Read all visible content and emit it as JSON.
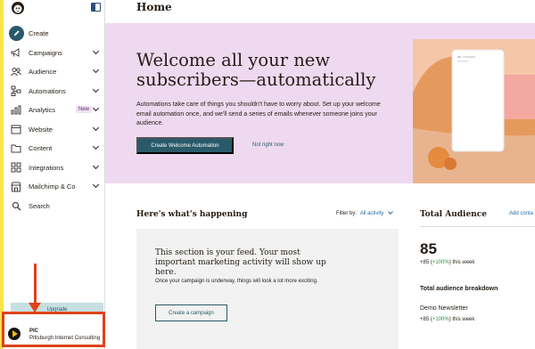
{
  "page": {
    "title": "Home"
  },
  "sidebar": {
    "items": [
      {
        "label": "Create",
        "icon": "pencil-icon"
      },
      {
        "label": "Campaigns",
        "icon": "megaphone-icon"
      },
      {
        "label": "Audience",
        "icon": "people-icon"
      },
      {
        "label": "Automations",
        "icon": "automation-icon"
      },
      {
        "label": "Analytics",
        "icon": "bar-chart-icon",
        "badge": "New"
      },
      {
        "label": "Website",
        "icon": "browser-window-icon"
      },
      {
        "label": "Content",
        "icon": "folder-icon"
      },
      {
        "label": "Integrations",
        "icon": "grid-icon"
      },
      {
        "label": "Mailchimp & Co",
        "icon": "store-icon"
      },
      {
        "label": "Search",
        "icon": "search-icon"
      }
    ],
    "upgrade_label": "Upgrade",
    "account": {
      "abbr": "PIC",
      "name": "Pittsburgh Internet Consulting"
    }
  },
  "hero": {
    "title": "Welcome all your new subscribers—automatically",
    "description": "Automations take care of things you shouldn't have to worry about. Set up your welcome email automation once, and we'll send a series of emails whenever someone joins your audience.",
    "primary_button": "Create Welcome Automation",
    "secondary_link": "Not right now"
  },
  "feed": {
    "heading": "Here's what's happening",
    "filter_label": "Filter by:",
    "filter_value": "All activity",
    "empty_title": "This section is your feed. Your most important marketing activity will show up here.",
    "empty_body": "Once your campaign is underway, things will look a lot more exciting.",
    "button": "Create a campaign"
  },
  "audience": {
    "title": "Total Audience",
    "add_link": "Add conta",
    "count": "85",
    "growth_prefix": "+85 (",
    "growth_pct": "+100%",
    "growth_suffix": ") this week",
    "breakdown_title": "Total audience breakdown",
    "list_name": "Demo Newsletter",
    "list_growth_prefix": "+85 (",
    "list_growth_pct": "+100%",
    "list_growth_suffix": ") this week"
  },
  "colors": {
    "accent": "#2a5a6a",
    "hero_bg": "#efd9f0",
    "annotation": "#e0421b",
    "link": "#2a6aa0",
    "positive": "#2b8a3e"
  }
}
